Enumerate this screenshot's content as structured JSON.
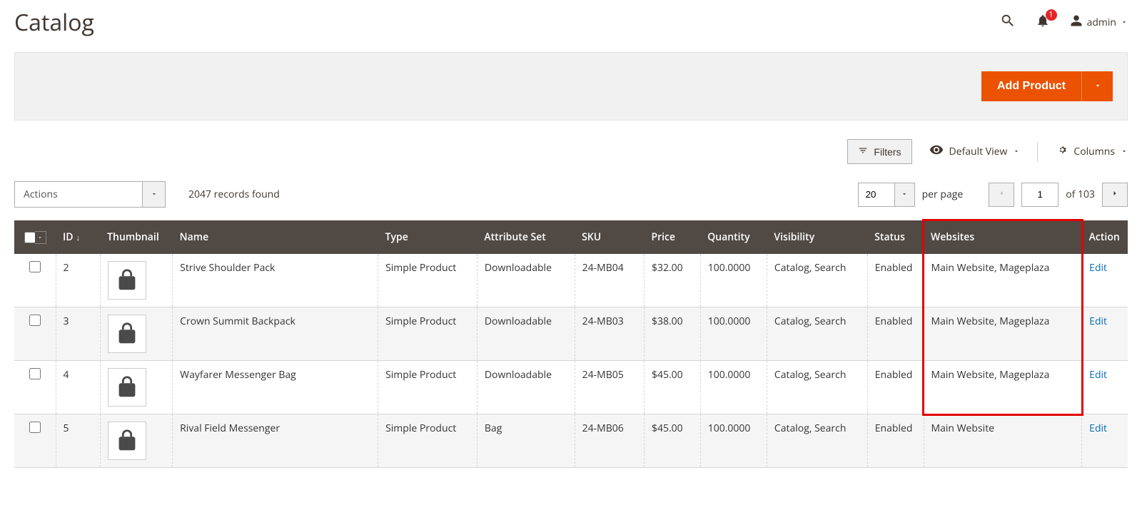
{
  "header": {
    "title": "Catalog",
    "notification_count": "1",
    "user_label": "admin"
  },
  "actionbar": {
    "add_product_label": "Add Product"
  },
  "toolbar": {
    "filters_label": "Filters",
    "default_view_label": "Default View",
    "columns_label": "Columns"
  },
  "listing": {
    "actions_label": "Actions",
    "records_found": "2047 records found",
    "per_page_value": "20",
    "per_page_label": "per page",
    "current_page": "1",
    "total_pages_label": "of 103"
  },
  "columns": {
    "id": "ID",
    "thumbnail": "Thumbnail",
    "name": "Name",
    "type": "Type",
    "attribute_set": "Attribute Set",
    "sku": "SKU",
    "price": "Price",
    "quantity": "Quantity",
    "visibility": "Visibility",
    "status": "Status",
    "websites": "Websites",
    "action": "Action"
  },
  "rows": [
    {
      "id": "2",
      "name": "Strive Shoulder Pack",
      "type": "Simple Product",
      "attribute_set": "Downloadable",
      "sku": "24-MB04",
      "price": "$32.00",
      "quantity": "100.0000",
      "visibility": "Catalog, Search",
      "status": "Enabled",
      "websites": "Main Website, Mageplaza",
      "action": "Edit"
    },
    {
      "id": "3",
      "name": "Crown Summit Backpack",
      "type": "Simple Product",
      "attribute_set": "Downloadable",
      "sku": "24-MB03",
      "price": "$38.00",
      "quantity": "100.0000",
      "visibility": "Catalog, Search",
      "status": "Enabled",
      "websites": "Main Website, Mageplaza",
      "action": "Edit"
    },
    {
      "id": "4",
      "name": "Wayfarer Messenger Bag",
      "type": "Simple Product",
      "attribute_set": "Downloadable",
      "sku": "24-MB05",
      "price": "$45.00",
      "quantity": "100.0000",
      "visibility": "Catalog, Search",
      "status": "Enabled",
      "websites": "Main Website, Mageplaza",
      "action": "Edit"
    },
    {
      "id": "5",
      "name": "Rival Field Messenger",
      "type": "Simple Product",
      "attribute_set": "Bag",
      "sku": "24-MB06",
      "price": "$45.00",
      "quantity": "100.0000",
      "visibility": "Catalog, Search",
      "status": "Enabled",
      "websites": "Main Website",
      "action": "Edit"
    }
  ]
}
